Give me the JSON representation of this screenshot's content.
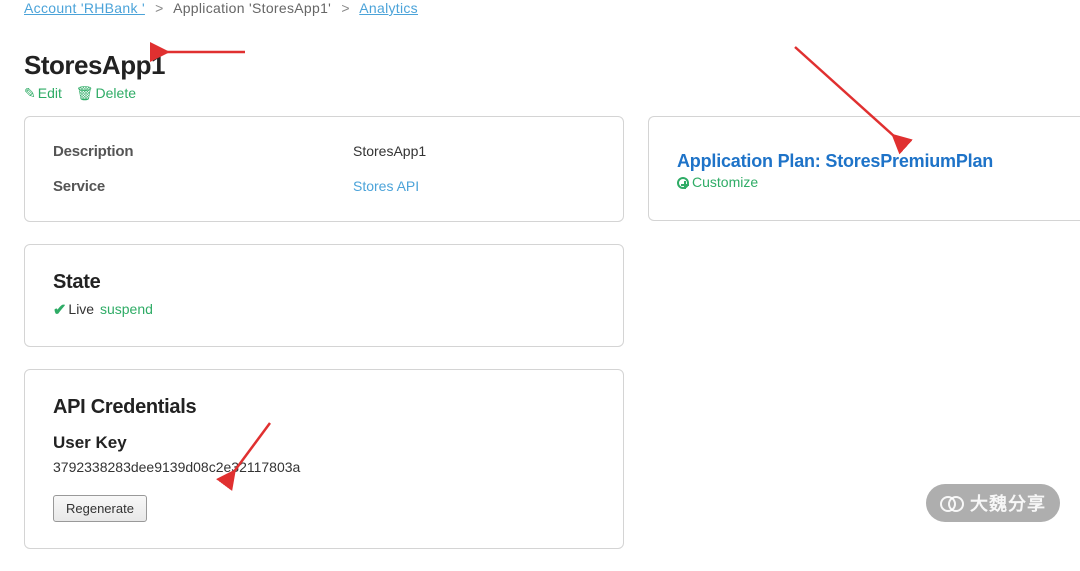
{
  "breadcrumb": {
    "account_link": "Account 'RHBank '",
    "application_label": "Application 'StoresApp1'",
    "analytics_link": "Analytics"
  },
  "page": {
    "title": "StoresApp1"
  },
  "actions": {
    "edit": "Edit",
    "delete": "Delete"
  },
  "details": {
    "description_label": "Description",
    "description_value": "StoresApp1",
    "service_label": "Service",
    "service_value": "Stores API"
  },
  "state": {
    "heading": "State",
    "status": "Live",
    "suspend_action": "suspend"
  },
  "credentials": {
    "heading": "API Credentials",
    "userkey_heading": "User Key",
    "userkey_value": "3792338283dee9139d08c2e32117803a",
    "regenerate": "Regenerate"
  },
  "plan": {
    "heading": "Application Plan: StoresPremiumPlan",
    "customize": "Customize"
  },
  "watermark": "大魏分享"
}
